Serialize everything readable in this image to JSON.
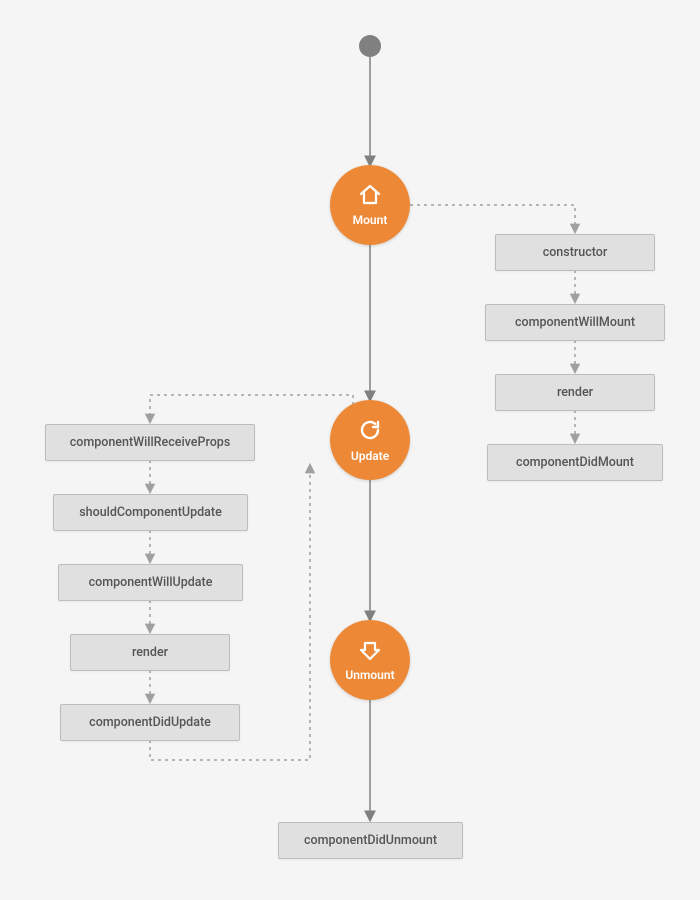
{
  "colors": {
    "accent": "#ed8936",
    "box_bg": "#e0e0e0",
    "box_border": "#bdbdbd",
    "edge_solid": "#808080",
    "edge_dotted": "#a0a0a0",
    "canvas_bg": "#f5f5f5"
  },
  "phases": {
    "mount": {
      "label": "Mount",
      "icon": "house-icon"
    },
    "update": {
      "label": "Update",
      "icon": "refresh-icon"
    },
    "unmount": {
      "label": "Unmount",
      "icon": "download-icon"
    }
  },
  "mount_methods": [
    "constructor",
    "componentWillMount",
    "render",
    "componentDidMount"
  ],
  "update_methods": [
    "componentWillReceiveProps",
    "shouldComponentUpdate",
    "componentWillUpdate",
    "render",
    "componentDidUpdate"
  ],
  "unmount_methods": [
    "componentDidUnmount"
  ]
}
